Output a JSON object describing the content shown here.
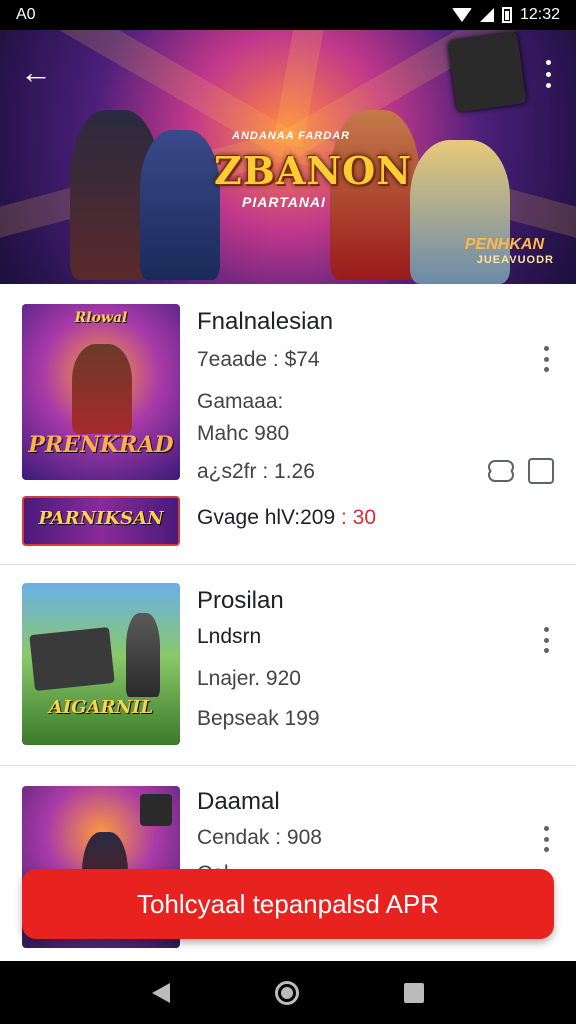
{
  "status_bar": {
    "left": "A0",
    "time": "12:32"
  },
  "hero": {
    "kicker": "ANDANAA FARDAR",
    "title": "ZBANON",
    "subtitle": "PIARTANAI",
    "corner_title": "PENHKAN",
    "corner_sub": "JUEAVUODR"
  },
  "items": [
    {
      "thumb_label": "PRENKRAD",
      "thumb_top_label": "Rlowal",
      "title": "Fnalnalesian",
      "lines": [
        "7eaade : $74",
        "Gamaaa:",
        "Mahc 980",
        "a¿s2fr : 1.26"
      ],
      "sub_banner": "PARNIKSAN",
      "sub_line_text": "Gvage hlV:209",
      "sub_line_red": "30"
    },
    {
      "thumb_label": "AIGARNIL",
      "title": "Prosilan",
      "lines": [
        "Lndsrn",
        "Lnajer. 920",
        "Bepseak 199"
      ]
    },
    {
      "title": "Daamal",
      "lines": [
        "Cendak : 908",
        "Col…"
      ]
    }
  ],
  "cta_label": "Tohlcyaal tepanpalsd APR",
  "colors": {
    "accent": "#e8231f",
    "divider": "#e0e0e0"
  }
}
